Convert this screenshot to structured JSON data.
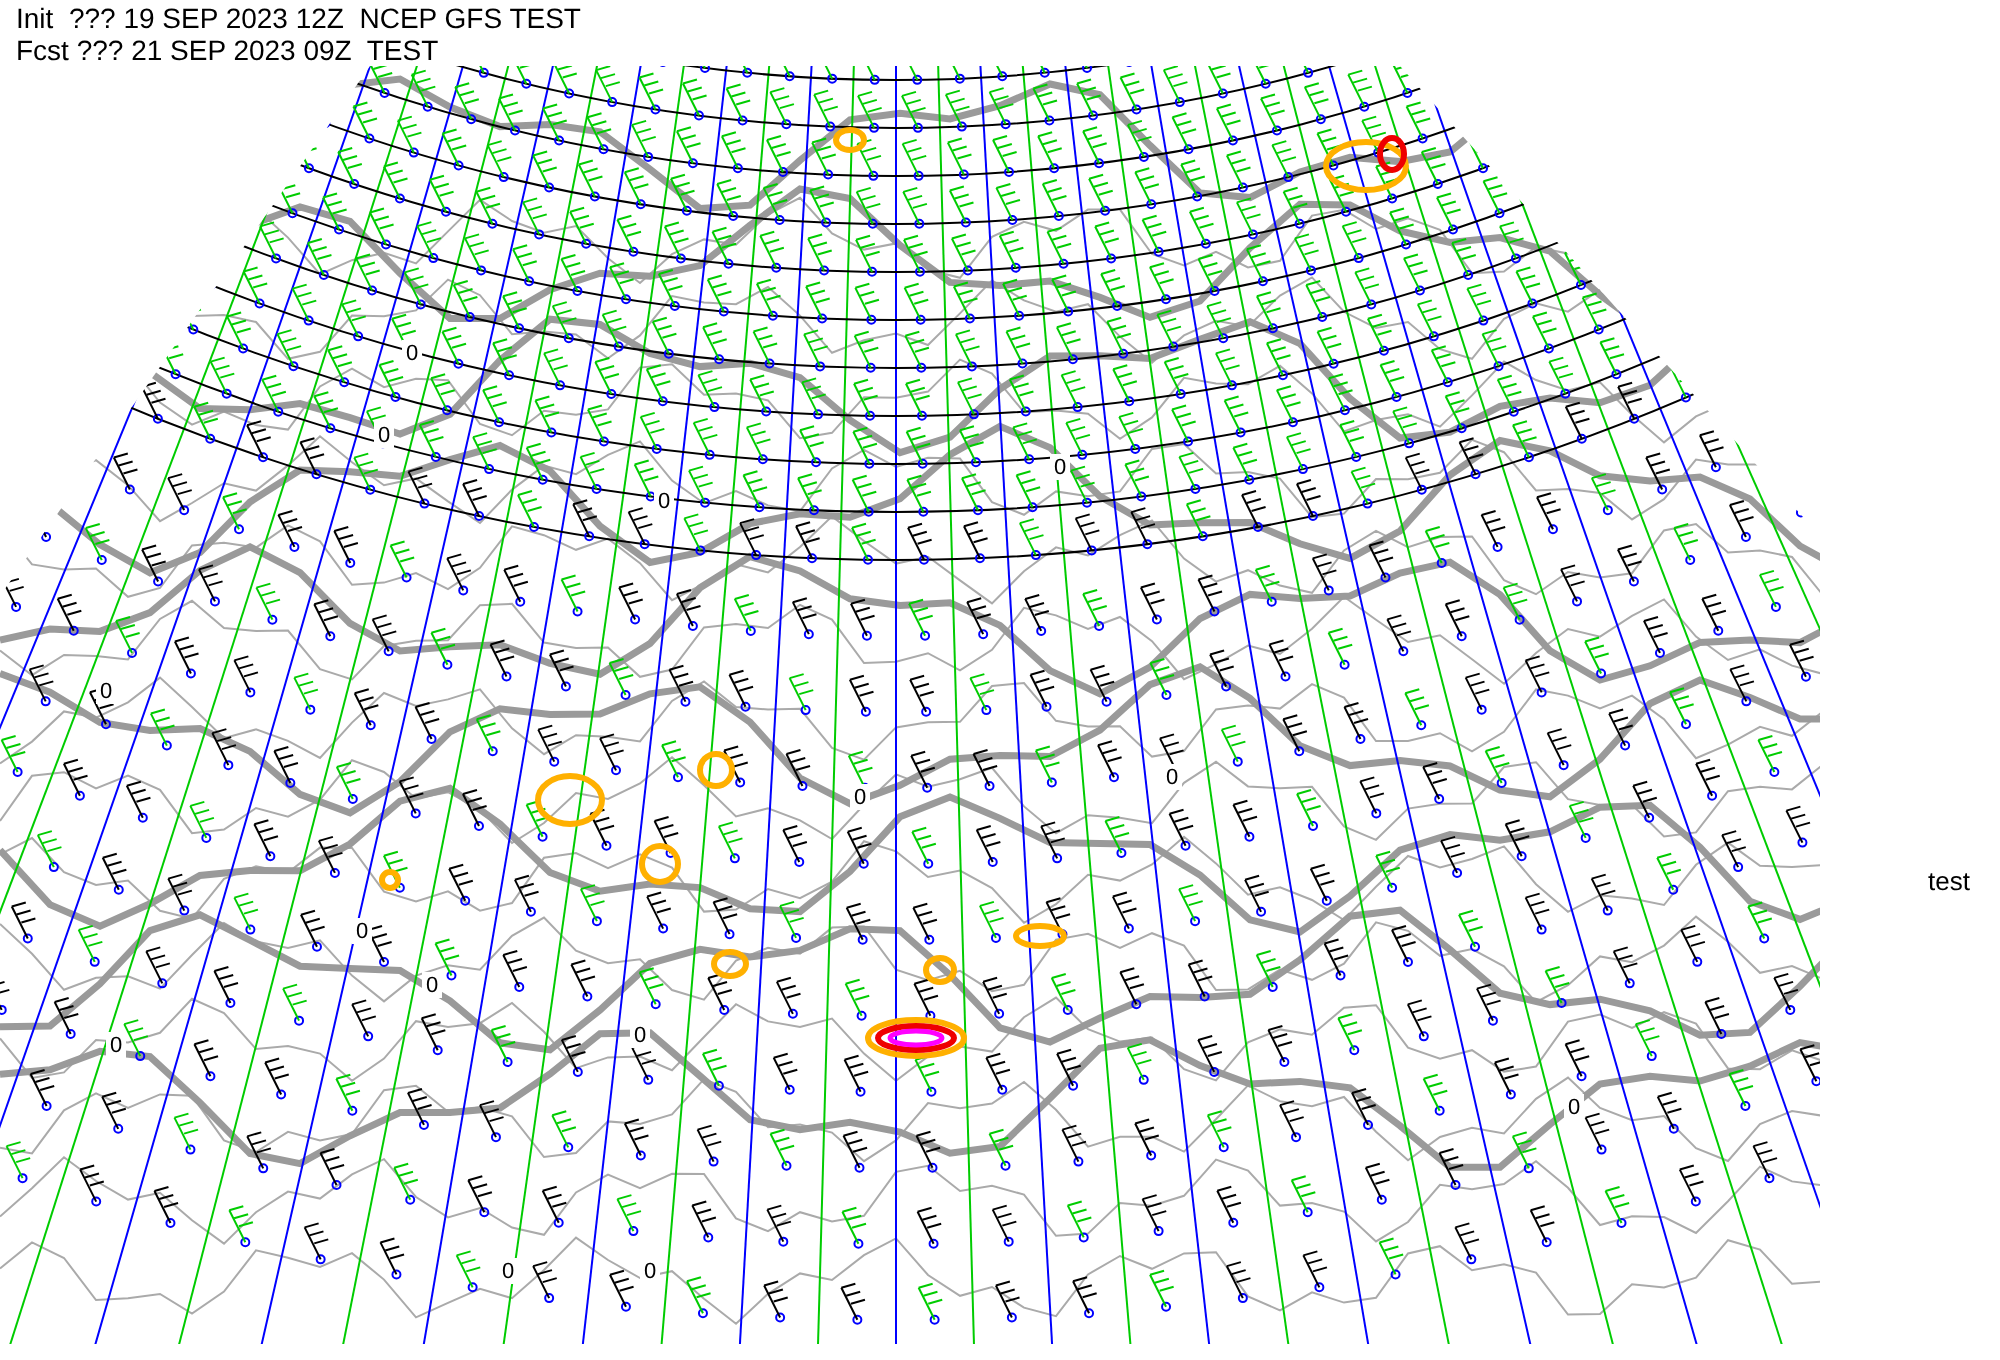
{
  "header": {
    "init": "Init  ??? 19 SEP 2023 12Z  NCEP GFS TEST",
    "forecast": "Fcst ??? 21 SEP 2023 09Z  TEST"
  },
  "side_label": "test",
  "contour_labels": [
    "0",
    "0",
    "0",
    "0",
    "0",
    "0",
    "0",
    "0",
    "0",
    "0",
    "0",
    "0",
    "0",
    "0"
  ]
}
